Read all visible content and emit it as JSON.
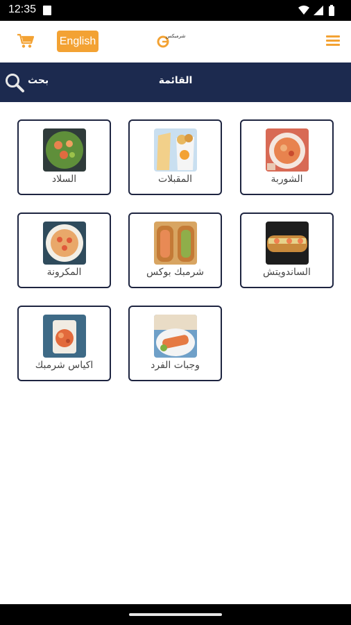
{
  "status_bar": {
    "time": "12:35"
  },
  "header": {
    "language_button": "English",
    "logo_text": "شرمبكس",
    "cart_icon": "cart-icon",
    "menu_icon": "hamburger-menu-icon"
  },
  "nav": {
    "search_label": "بحث",
    "title": "القائمة",
    "search_icon": "magnifier-icon"
  },
  "colors": {
    "accent": "#f3a233",
    "nav_bg": "#1c2a4f",
    "card_border": "#1d2440"
  },
  "categories": [
    {
      "label": "الشوربة",
      "image": "soup"
    },
    {
      "label": "المقبلات",
      "image": "appetizers"
    },
    {
      "label": "السلاد",
      "image": "salad"
    },
    {
      "label": "الساندويتش",
      "image": "sandwich"
    },
    {
      "label": "شرمبك بوكس",
      "image": "shrimp-box"
    },
    {
      "label": "المكرونة",
      "image": "pasta"
    },
    {
      "label": "وجبات الفرد",
      "image": "individual-meals"
    },
    {
      "label": "اكياس شرمبك",
      "image": "shrimp-bags"
    }
  ]
}
